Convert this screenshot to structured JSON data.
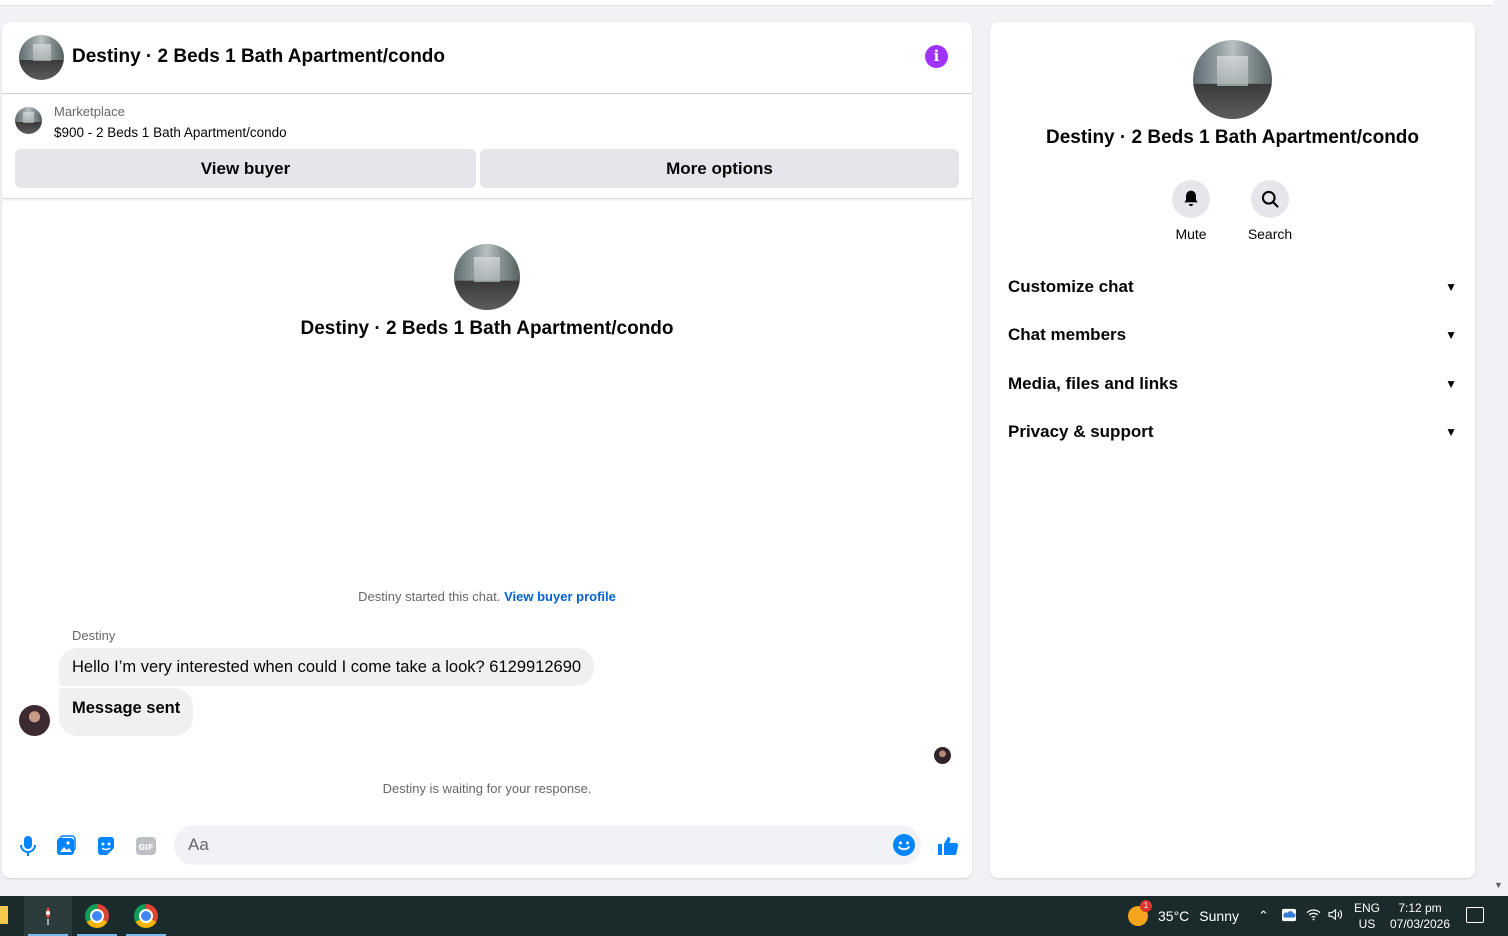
{
  "chat": {
    "title": "Destiny · 2 Beds 1 Bath Apartment/condo",
    "listing": {
      "source": "Marketplace",
      "price_title": "$900 - 2 Beds 1 Bath Apartment/condo",
      "view_buyer_label": "View buyer",
      "more_options_label": "More options"
    },
    "intro_title": "Destiny · 2 Beds 1 Bath Apartment/condo",
    "started_text": "Destiny started this chat.",
    "view_profile_link": "View buyer profile",
    "sender_name": "Destiny",
    "messages": [
      {
        "text": "Hello I’m very interested when could I come take a look? 6129912690"
      },
      {
        "text": "Message sent"
      }
    ],
    "waiting_text": "Destiny is waiting for your response.",
    "composer": {
      "placeholder": "Aa",
      "icons": [
        "microphone-icon",
        "image-icon",
        "sticker-icon",
        "gif-icon",
        "emoji-icon",
        "thumbs-up-icon"
      ]
    }
  },
  "side": {
    "title": "Destiny · 2 Beds 1 Bath Apartment/condo",
    "actions": [
      {
        "label": "Mute",
        "icon": "bell-icon"
      },
      {
        "label": "Search",
        "icon": "search-icon"
      }
    ],
    "sections": [
      {
        "label": "Customize chat"
      },
      {
        "label": "Chat members"
      },
      {
        "label": "Media, files and links"
      },
      {
        "label": "Privacy & support"
      }
    ]
  },
  "taskbar": {
    "weather": {
      "temp": "35°C",
      "condition": "Sunny",
      "badge": "1"
    },
    "lang_top": "ENG",
    "lang_bottom": "US",
    "time": "7:12 pm",
    "date": "07/03/2026"
  },
  "colors": {
    "accent_blue": "#0084ff",
    "info_purple": "#a033ff",
    "link_blue": "#0064d1"
  }
}
